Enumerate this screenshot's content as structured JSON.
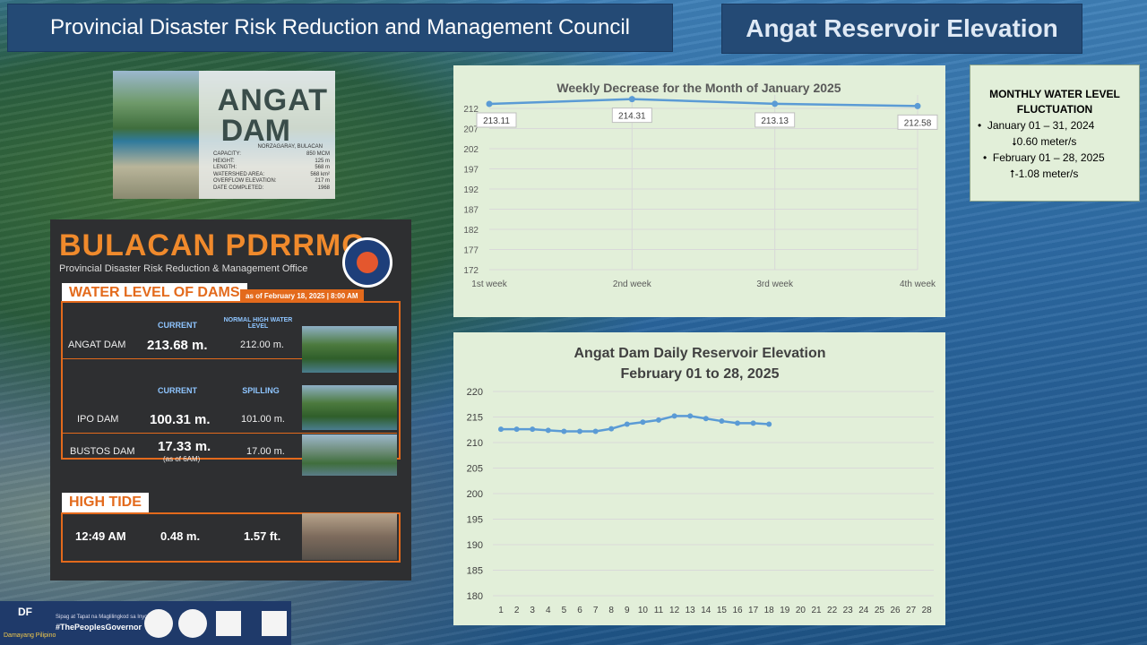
{
  "header": {
    "council": "Provincial Disaster Risk Reduction and Management Council",
    "page_title": "Angat Reservoir Elevation"
  },
  "dam_photo": {
    "title_line1": "ANGAT",
    "title_line2": "DAM",
    "location": "NORZAGARAY, BULACAN",
    "specs": [
      {
        "k": "CAPACITY:",
        "v": "850 MCM"
      },
      {
        "k": "HEIGHT:",
        "v": "125 m"
      },
      {
        "k": "LENGTH:",
        "v": "568 m"
      },
      {
        "k": "WATERSHED AREA:",
        "v": "568 km²"
      },
      {
        "k": "OVERFLOW ELEVATION:",
        "v": "217 m"
      },
      {
        "k": "DATE COMPLETED:",
        "v": "1968"
      }
    ]
  },
  "poster": {
    "brand": "BULACAN PDRRMO",
    "office": "Provincial Disaster Risk Reduction & Management Office",
    "section_title": "WATER LEVEL OF DAMS",
    "as_of": "as of February 18, 2025 | 8:00 AM",
    "col_current": "CURRENT",
    "col_normal_high": "NORMAL HIGH WATER LEVEL",
    "col_spilling": "SPILLING",
    "angat": {
      "name": "ANGAT DAM",
      "current": "213.68 m.",
      "normal": "212.00 m."
    },
    "ipo": {
      "name": "IPO DAM",
      "current": "100.31 m.",
      "spilling": "101.00 m."
    },
    "bustos": {
      "name": "BUSTOS DAM",
      "current": "17.33 m.",
      "note": "(as of 6AM)",
      "spilling": "17.00 m."
    },
    "tide_title": "HIGH TIDE",
    "tide": {
      "time": "12:49 AM",
      "meters": "0.48 m.",
      "feet": "1.57 ft."
    }
  },
  "footer": {
    "df": "DF",
    "dp": "Damayang Pilipino",
    "tagline": "Sipag at Tapat na Maglilingkod sa Inyo",
    "hashtag": "#ThePeoplesGovernor"
  },
  "fluctuation": {
    "title": "MONTHLY WATER LEVEL FLUCTUATION",
    "items": [
      {
        "period": "January 01 – 31, 2024",
        "change": "0.60 meter/s",
        "arrow": "⭣"
      },
      {
        "period": "February 01 – 28, 2025",
        "change": "-1.08 meter/s",
        "arrow": "⭡"
      }
    ]
  },
  "chart_data": [
    {
      "type": "line",
      "title": "Weekly Decrease for the Month of  January 2025",
      "categories": [
        "1st week",
        "2nd week",
        "3rd week",
        "4th week"
      ],
      "values": [
        213.11,
        214.31,
        213.13,
        212.58
      ],
      "data_labels": [
        "213.11",
        "214.31",
        "213.13",
        "212.58"
      ],
      "ylim": [
        172,
        212
      ],
      "yticks": [
        172,
        177,
        182,
        187,
        192,
        197,
        202,
        207,
        212
      ],
      "color": "#5b9bd5",
      "grid": true
    },
    {
      "type": "line",
      "title": "Angat Dam Daily Reservoir Elevation",
      "subtitle": "February 01 to 28, 2025",
      "x": [
        1,
        2,
        3,
        4,
        5,
        6,
        7,
        8,
        9,
        10,
        11,
        12,
        13,
        14,
        15,
        16,
        17,
        18,
        19,
        20,
        21,
        22,
        23,
        24,
        25,
        26,
        27,
        28
      ],
      "values": [
        212.6,
        212.6,
        212.6,
        212.4,
        212.2,
        212.2,
        212.2,
        212.7,
        213.6,
        214.0,
        214.4,
        215.2,
        215.2,
        214.7,
        214.2,
        213.8,
        213.8,
        213.6
      ],
      "ylim": [
        180,
        220
      ],
      "yticks": [
        180,
        185,
        190,
        195,
        200,
        205,
        210,
        215,
        220
      ],
      "color": "#5b9bd5",
      "grid": true
    }
  ]
}
